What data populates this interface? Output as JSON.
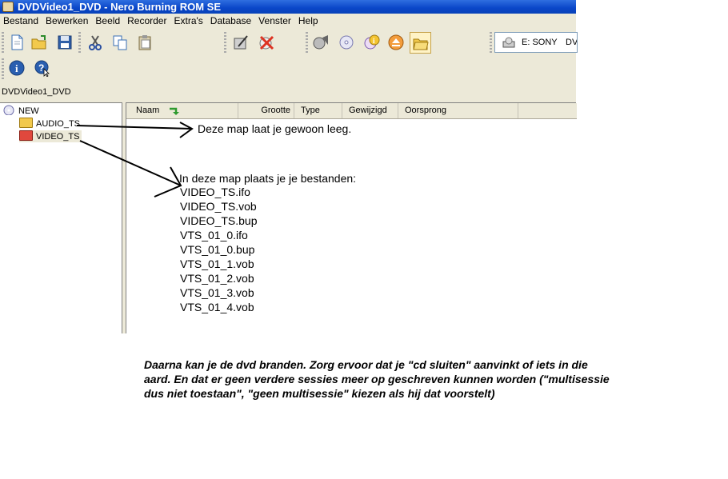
{
  "window": {
    "title": "DVDVideo1_DVD - Nero Burning ROM SE"
  },
  "menu": [
    "Bestand",
    "Bewerken",
    "Beeld",
    "Recorder",
    "Extra's",
    "Database",
    "Venster",
    "Help"
  ],
  "drive": {
    "label": "E: SONY",
    "label_cut": "DV"
  },
  "path": "DVDVideo1_DVD",
  "tree": {
    "root": "NEW",
    "folders": [
      "AUDIO_TS",
      "VIDEO_TS"
    ]
  },
  "columns": {
    "naam": "Naam",
    "grootte": "Grootte",
    "type": "Type",
    "gewijzigd": "Gewijzigd",
    "oorsprong": "Oorsprong"
  },
  "annotations": {
    "audio_note": "Deze map laat je gewoon leeg.",
    "video_note": "In deze map plaats je je bestanden:",
    "files": [
      "VIDEO_TS.ifo",
      "VIDEO_TS.vob",
      "VIDEO_TS.bup",
      "VTS_01_0.ifo",
      "VTS_01_0.bup",
      "VTS_01_1.vob",
      "VTS_01_2.vob",
      "VTS_01_3.vob",
      "VTS_01_4.vob"
    ],
    "footer": "Daarna kan je de dvd branden. Zorg ervoor dat je \"cd sluiten\" aanvinkt of iets in die aard. En dat er geen verdere sessies meer op geschreven kunnen worden (\"multisessie dus niet toestaan\", \"geen multisessie\" kiezen als hij dat voorstelt)"
  },
  "colors": {
    "titlebar": "#0a46c8",
    "chrome": "#ece9d8",
    "video_folder": "#e0483d",
    "audio_folder": "#f2c94c"
  }
}
